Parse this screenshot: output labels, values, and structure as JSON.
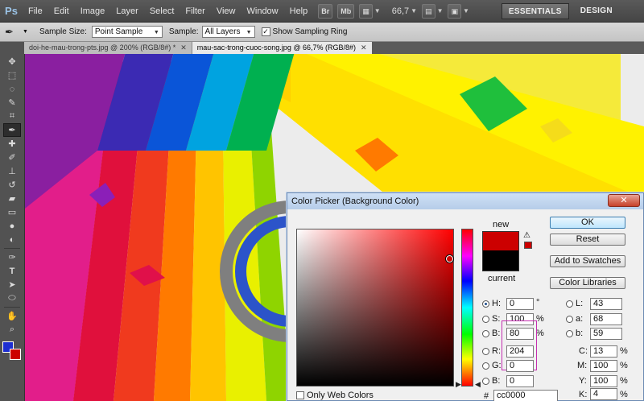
{
  "app": {
    "logo": "Ps",
    "zoom": "66,7"
  },
  "menu": [
    "File",
    "Edit",
    "Image",
    "Layer",
    "Select",
    "Filter",
    "View",
    "Window",
    "Help"
  ],
  "menubar_buttons": {
    "bridge": "Br",
    "minibridge": "Mb"
  },
  "workspaces": {
    "essentials": "ESSENTIALS",
    "design": "DESIGN"
  },
  "options": {
    "sample_size_label": "Sample Size:",
    "sample_size_value": "Point Sample",
    "sample_label": "Sample:",
    "sample_value": "All Layers",
    "show_ring_label": "Show Sampling Ring",
    "show_ring_checked": true
  },
  "tabs": [
    {
      "label": "doi-he-mau-trong-pts.jpg @ 200% (RGB/8#) *",
      "active": false
    },
    {
      "label": "mau-sac-trong-cuoc-song.jpg @ 66,7% (RGB/8#)",
      "active": true
    }
  ],
  "colors": {
    "foreground": "#1d2ed0",
    "background": "#cc0000",
    "new": "#cc0000",
    "current": "#000000"
  },
  "dialog": {
    "title": "Color Picker (Background Color)",
    "new_label": "new",
    "current_label": "current",
    "buttons": {
      "ok": "OK",
      "reset": "Reset",
      "add_swatches": "Add to Swatches",
      "libraries": "Color Libraries"
    },
    "fields": {
      "H": {
        "label": "H:",
        "value": "0",
        "unit": "°"
      },
      "S": {
        "label": "S:",
        "value": "100",
        "unit": "%"
      },
      "B": {
        "label": "B:",
        "value": "80",
        "unit": "%"
      },
      "R": {
        "label": "R:",
        "value": "204"
      },
      "G": {
        "label": "G:",
        "value": "0"
      },
      "Bl": {
        "label": "B:",
        "value": "0"
      },
      "L": {
        "label": "L:",
        "value": "43"
      },
      "a": {
        "label": "a:",
        "value": "68"
      },
      "b": {
        "label": "b:",
        "value": "59"
      },
      "C": {
        "label": "C:",
        "value": "13",
        "unit": "%"
      },
      "M": {
        "label": "M:",
        "value": "100",
        "unit": "%"
      },
      "Y": {
        "label": "Y:",
        "value": "100",
        "unit": "%"
      },
      "K": {
        "label": "K:",
        "value": "4",
        "unit": "%"
      }
    },
    "hex_label": "#",
    "hex_value": "cc0000",
    "only_web_colors": "Only Web Colors"
  }
}
